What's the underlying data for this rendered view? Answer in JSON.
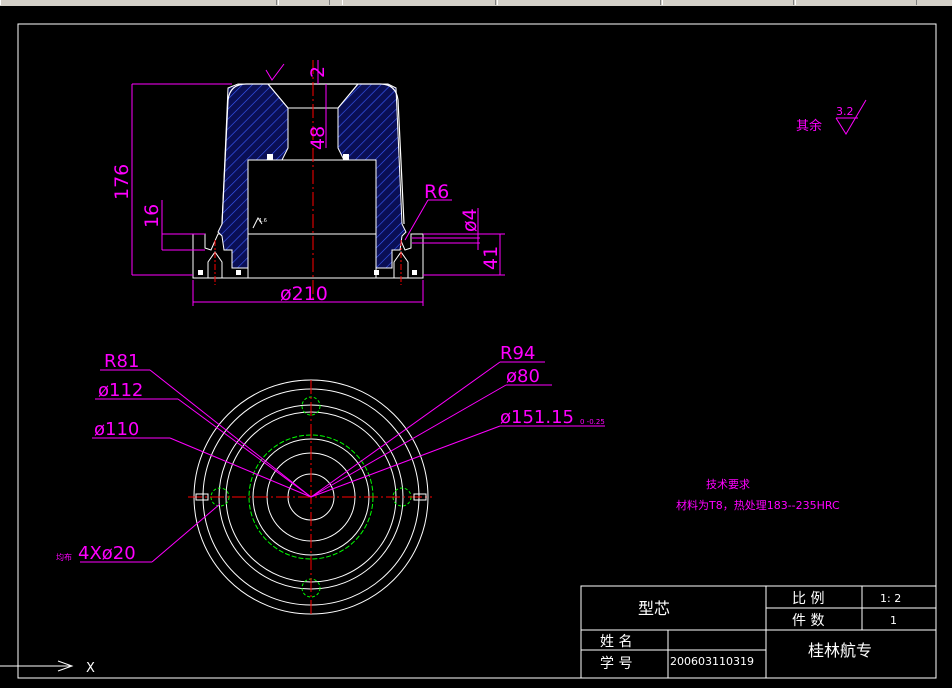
{
  "colors": {
    "background": "#000000",
    "frame": "#ffffff",
    "dimension": "#ff00ff",
    "centerline": "#ff0000",
    "hatch": "#3a5bff",
    "hidden": "#00ff00",
    "geometry": "#ffffff"
  },
  "section_view": {
    "dims": {
      "surface_top": "√",
      "top_depth": "2",
      "inner_depth": "48",
      "height": "176",
      "flange_height": "16",
      "fillet": "R6",
      "slot_width": "ø4",
      "base_height": "41",
      "base_diameter": "ø210",
      "surface_side": "√"
    }
  },
  "plan_view": {
    "leaders": [
      {
        "label": "R81"
      },
      {
        "label": "ø112"
      },
      {
        "label": "ø110"
      },
      {
        "label": "4Xø20"
      },
      {
        "label": "R94"
      },
      {
        "label": "ø80"
      },
      {
        "label": "ø151.15",
        "tolerance": "0 -0.25"
      }
    ],
    "small_note": "均布"
  },
  "roughness_note": {
    "label": "其余",
    "value": "3.2"
  },
  "tech_requirements": {
    "title": "技术要求",
    "line1": "材料为T8，热处理183--235HRC"
  },
  "title_block": {
    "part_name": "型芯",
    "scale_label": "比 例",
    "scale_value": "1: 2",
    "qty_label": "件 数",
    "qty_value": "1",
    "name_label": "姓 名",
    "name_value": "",
    "id_label": "学 号",
    "id_value": "200603110319",
    "school": "桂林航专"
  },
  "ucs": {
    "x_label": "X"
  }
}
